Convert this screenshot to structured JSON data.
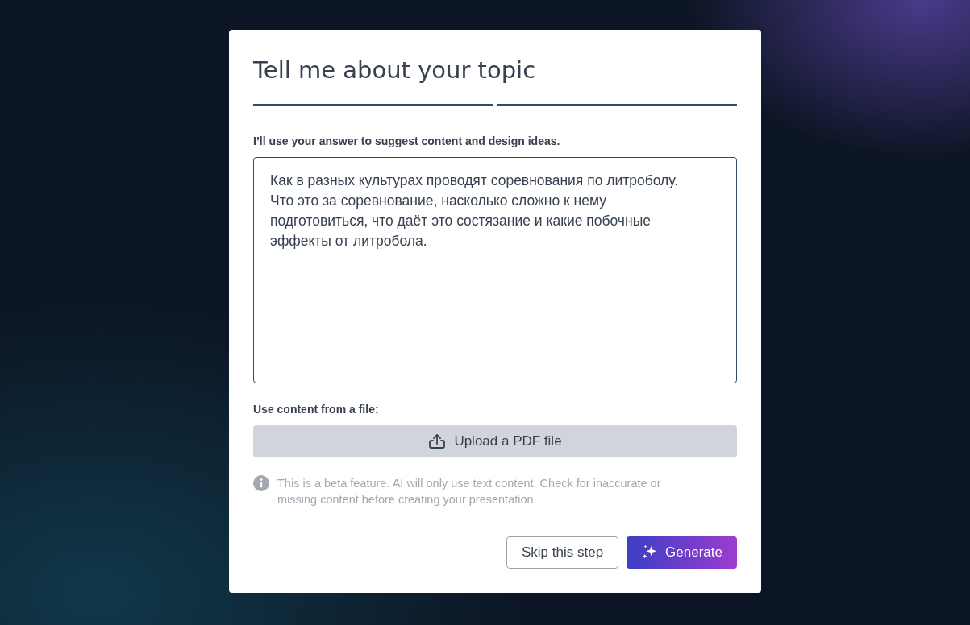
{
  "dialog": {
    "title": "Tell me about your topic",
    "steps": [
      {
        "done": true
      },
      {
        "done": true
      }
    ],
    "prompt_label": "I’ll use your answer to suggest content and design ideas.",
    "topic_field": {
      "value": "Как в разных культурах проводят соревнования по литроболу. Что это за соревнование, насколько сложно к нему подготовиться, что даёт это состязание и какие побочные эффекты от литробола."
    },
    "file_label": "Use content from a file:",
    "upload_button": "Upload a PDF file",
    "note": "This is a beta feature. AI will only use text content. Check for inaccurate or missing content before creating your presentation.",
    "buttons": [
      {
        "kind": "secondary",
        "label": "Skip this step"
      },
      {
        "kind": "primary",
        "label": "Generate"
      }
    ]
  }
}
